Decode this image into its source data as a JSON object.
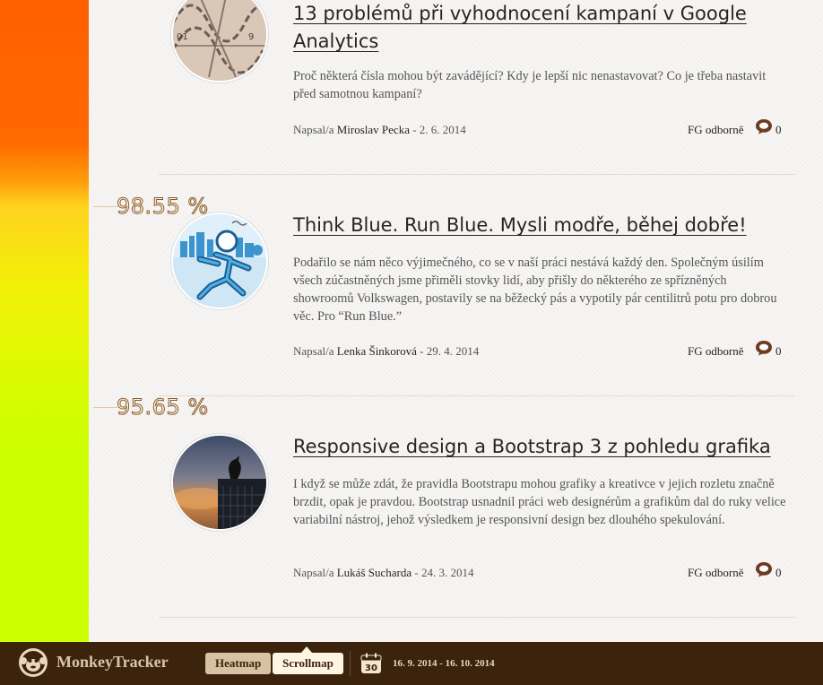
{
  "scrollmap": {
    "colors": {
      "top": "#ff5f00",
      "middle": "#ffd21f",
      "bottom": "#ccff00"
    },
    "markers": [
      {
        "label": "98.55 %",
        "value": 98.55
      },
      {
        "label": "95.65 %",
        "value": 95.65
      }
    ]
  },
  "articles": [
    {
      "title": "13 problémů při vyhodnocení kampaní v Google Analytics",
      "excerpt": "Proč některá čísla mohou být zavádějící? Kdy je lepší nic nenastavovat? Co je třeba nastavit před samotnou kampaní?",
      "author_prefix": "Napsal/a",
      "author": "Miroslav Pecka",
      "date": " - 2. 6. 2014",
      "category": "FG odborně",
      "comments": "0",
      "thumb_icon": "chart-lines-thumbnail"
    },
    {
      "title": "Think Blue. Run Blue. Mysli modře, běhej dobře!",
      "excerpt": "Podařilo se nám něco výjimečného, co se v naší práci nestává každý den. Společným úsilím všech zúčastněných jsme přiměli stovky lidí, aby přišly do některého ze spřízněných showroomů Volkswagen, postavily se na běžecký pás a vypotily pár centilitrů potu pro dobrou věc. Pro “Run Blue.”",
      "author_prefix": "Napsal/a",
      "author": "Lenka Šinkorová",
      "date": " - 29. 4. 2014",
      "category": "FG odborně",
      "comments": "0",
      "thumb_icon": "runner-thumbnail"
    },
    {
      "title": "Responsive design a Bootstrap 3 z pohledu grafika",
      "excerpt": "I když se může zdát, že pravidla Bootstrapu mohou grafiky a kreativce v jejich rozletu značně brzdit, opak je pravdou. Bootstrap usnadnil práci web designérům a grafikům dal do ruky velice variabilní nástroj, jehož výsledkem je responsivní design bez dlouhého spekulování.",
      "author_prefix": "Napsal/a",
      "author": "Lukáš Sucharda",
      "date": " - 24. 3. 2014",
      "category": "FG odborně",
      "comments": "0",
      "thumb_icon": "bird-sunset-thumbnail"
    }
  ],
  "toolbar": {
    "brand": "MonkeyTracker",
    "heatmap_label": "Heatmap",
    "scrollmap_label": "Scrollmap",
    "calendar_day": "30",
    "date_range": "16. 9. 2014 - 16. 10. 2014"
  }
}
